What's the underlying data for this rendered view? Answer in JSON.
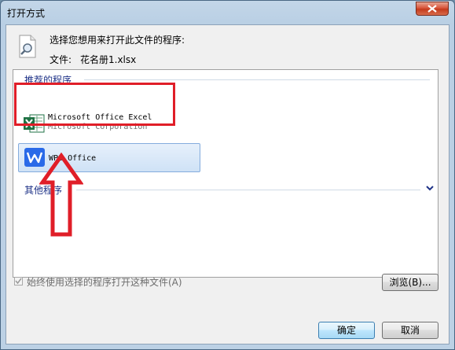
{
  "window": {
    "title": "打开方式"
  },
  "header": {
    "prompt": "选择您想用来打开此文件的程序:",
    "file_label": "文件:",
    "file_name": "花名册1.xlsx"
  },
  "recommended": {
    "header": "推荐的程序",
    "programs": [
      {
        "name": "Microsoft Office Excel",
        "company": "Microsoft Corporation",
        "icon": "excel-icon"
      },
      {
        "name": "WPS Office",
        "company": "",
        "icon": "wps-icon"
      }
    ]
  },
  "other": {
    "header": "其他程序"
  },
  "options": {
    "always_use_label": "始终使用选择的程序打开这种文件(A)",
    "always_use_checked": true
  },
  "buttons": {
    "browse": "浏览(B)...",
    "ok": "确定",
    "cancel": "取消"
  },
  "colors": {
    "highlight": "#e01e28",
    "link_blue": "#1e3287",
    "excel_green": "#1f7244",
    "wps_blue": "#2a6ae8"
  }
}
